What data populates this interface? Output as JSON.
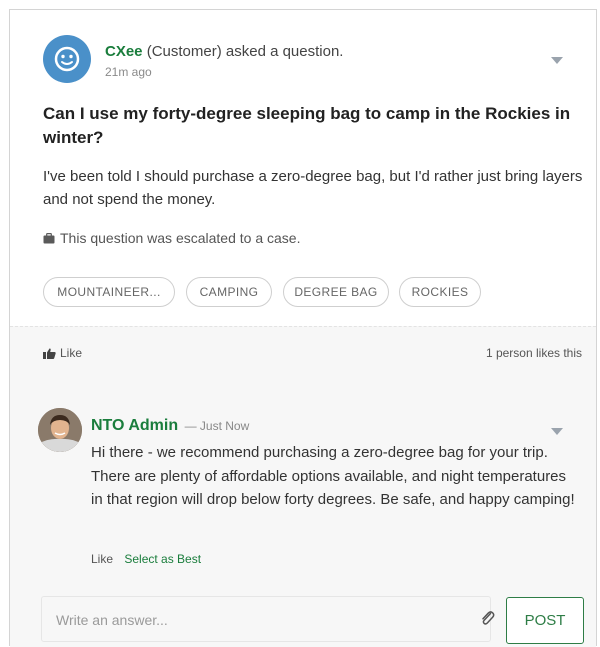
{
  "question": {
    "author_name": "CXee",
    "author_role": "(Customer)",
    "action": "asked a question.",
    "time": "21m ago",
    "title": "Can I use my forty-degree sleeping bag to camp in the Rockies in winter?",
    "body": "I've been told I should purchase a zero-degree bag, but I'd rather just bring layers and not spend the money.",
    "escalation": "This question was escalated to a case.",
    "tags": [
      "MOUNTAINEER...",
      "CAMPING",
      "DEGREE BAG",
      "ROCKIES"
    ]
  },
  "like_bar": {
    "like_label": "Like",
    "count_text": "1 person likes this"
  },
  "answer": {
    "author_name": "NTO Admin",
    "time": "— Just Now",
    "body": "Hi there - we recommend purchasing a zero-degree bag for your trip. There are plenty of affordable options available, and night temperatures in that region will drop below forty degrees. Be safe, and happy camping!",
    "like_label": "Like",
    "best_label": "Select as Best"
  },
  "composer": {
    "placeholder": "Write an answer...",
    "value": "",
    "post_label": "POST"
  },
  "colors": {
    "author_green": "#1a7d3c",
    "avatar_blue": "#4a90c9",
    "post_border": "#2e7d46"
  },
  "icons": [
    "smiley-avatar-icon",
    "caret-down-icon",
    "briefcase-icon",
    "thumbs-up-icon",
    "paperclip-icon"
  ]
}
